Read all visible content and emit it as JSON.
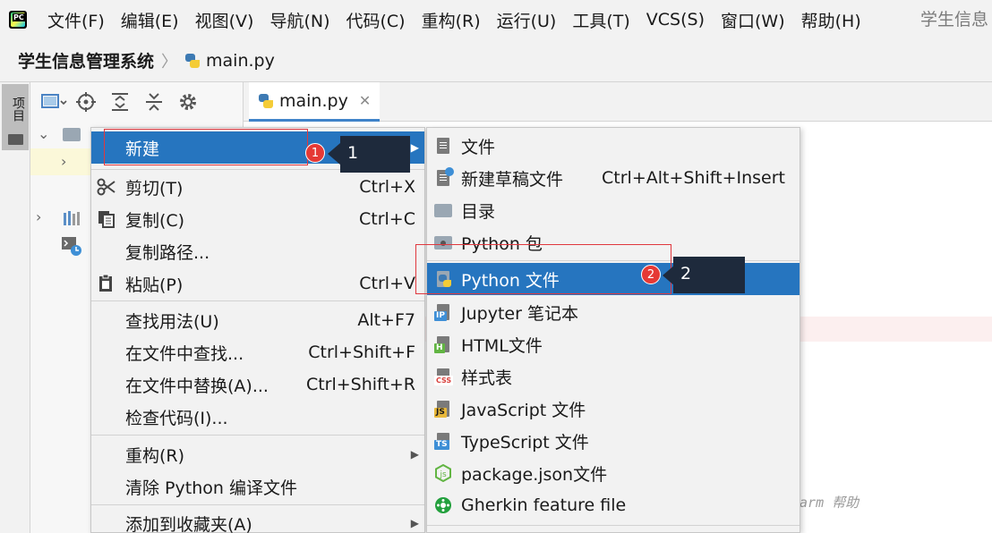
{
  "menubar": {
    "items": [
      "文件(F)",
      "编辑(E)",
      "视图(V)",
      "导航(N)",
      "代码(C)",
      "重构(R)",
      "运行(U)",
      "工具(T)",
      "VCS(S)",
      "窗口(W)",
      "帮助(H)"
    ],
    "window_title": "学生信息"
  },
  "breadcrumb": {
    "project": "学生信息管理系统",
    "file": "main.py"
  },
  "stripe": {
    "project_tab": "项目"
  },
  "editor": {
    "tab_label": "main.py",
    "hint_text": "harm 帮助"
  },
  "context_menu": {
    "items": [
      {
        "label": "新建",
        "shortcut": "",
        "submenu": true,
        "selected": true,
        "icon": ""
      },
      {
        "label": "剪切(T)",
        "shortcut": "Ctrl+X",
        "icon": "scissors-icon"
      },
      {
        "label": "复制(C)",
        "shortcut": "Ctrl+C",
        "icon": "copy-icon"
      },
      {
        "label": "复制路径...",
        "shortcut": ""
      },
      {
        "label": "粘贴(P)",
        "shortcut": "Ctrl+V",
        "icon": "clipboard-icon"
      },
      {
        "label": "查找用法(U)",
        "shortcut": "Alt+F7"
      },
      {
        "label": "在文件中查找...",
        "shortcut": "Ctrl+Shift+F"
      },
      {
        "label": "在文件中替换(A)...",
        "shortcut": "Ctrl+Shift+R"
      },
      {
        "label": "检查代码(I)...",
        "shortcut": ""
      },
      {
        "label": "重构(R)",
        "shortcut": "",
        "submenu": true
      },
      {
        "label": "清除 Python 编译文件",
        "shortcut": ""
      },
      {
        "label": "添加到收藏夹(A)",
        "shortcut": "",
        "submenu": true
      }
    ]
  },
  "submenu": {
    "items": [
      {
        "label": "文件",
        "shortcut": "",
        "icon": "file-icon"
      },
      {
        "label": "新建草稿文件",
        "shortcut": "Ctrl+Alt+Shift+Insert",
        "icon": "scratch-file-icon"
      },
      {
        "label": "目录",
        "shortcut": "",
        "icon": "folder-icon"
      },
      {
        "label": "Python 包",
        "shortcut": "",
        "icon": "python-package-icon"
      },
      {
        "label": "Python 文件",
        "shortcut": "",
        "icon": "python-file-icon",
        "selected": true
      },
      {
        "label": "Jupyter 笔记本",
        "shortcut": "",
        "icon": "jupyter-icon",
        "badge": "IP"
      },
      {
        "label": "HTML文件",
        "shortcut": "",
        "icon": "html-file-icon",
        "badge": "H"
      },
      {
        "label": "样式表",
        "shortcut": "",
        "icon": "css-file-icon",
        "badge": "CSS"
      },
      {
        "label": "JavaScript 文件",
        "shortcut": "",
        "icon": "js-file-icon",
        "badge": "JS"
      },
      {
        "label": "TypeScript 文件",
        "shortcut": "",
        "icon": "ts-file-icon",
        "badge": "TS"
      },
      {
        "label": "package.json文件",
        "shortcut": "",
        "icon": "nodejs-icon"
      },
      {
        "label": "Gherkin feature file",
        "shortcut": "",
        "icon": "cucumber-icon"
      }
    ]
  },
  "annotations": {
    "step1_number": "1",
    "step1_callout": "1",
    "step2_number": "2",
    "step2_callout": "2"
  },
  "colors": {
    "selection": "#2675bf",
    "annotation_red": "#e53935",
    "callout_bg": "#1e2a3c"
  }
}
